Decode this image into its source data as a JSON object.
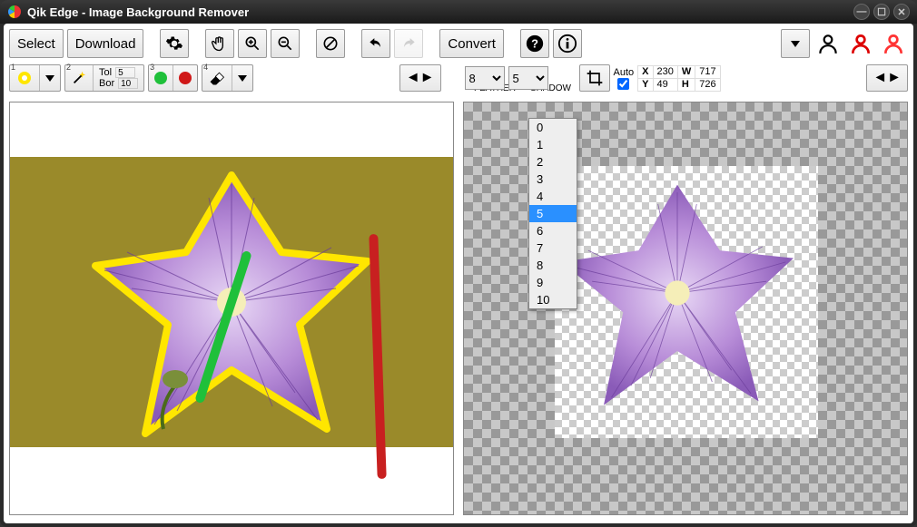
{
  "window": {
    "title": "Qik Edge - Image Background Remover"
  },
  "toolbar": {
    "select": "Select",
    "download": "Download",
    "convert": "Convert"
  },
  "toolbox": {
    "tol_label": "Tol",
    "tol_value": "5",
    "bor_label": "Bor",
    "bor_value": "10",
    "badge1": "1",
    "badge2": "2",
    "badge3": "3",
    "badge4": "4"
  },
  "labels": {
    "feather": "FEATHER",
    "shadow": "SHADOW"
  },
  "feather": {
    "value": "8"
  },
  "shadow": {
    "value": "5",
    "options": [
      "0",
      "1",
      "2",
      "3",
      "4",
      "5",
      "6",
      "7",
      "8",
      "9",
      "10"
    ]
  },
  "crop": {
    "auto_label": "Auto",
    "auto_checked": true,
    "x_label": "X",
    "x": "230",
    "y_label": "Y",
    "y": "49",
    "w_label": "W",
    "w": "717",
    "h_label": "H",
    "h": "726"
  },
  "colors": {
    "yellow": "#ffe600",
    "green": "#1fc03a",
    "red": "#d01818",
    "accent": "#2a90ff"
  }
}
